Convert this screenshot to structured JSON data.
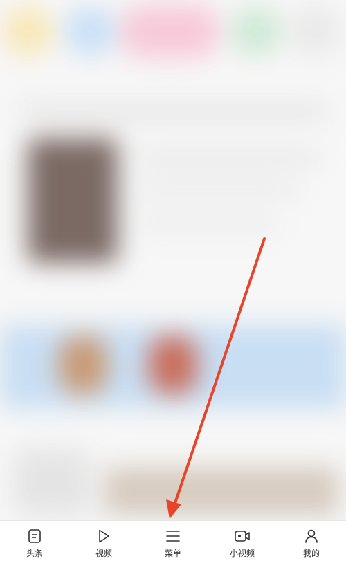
{
  "bottom_nav": {
    "items": [
      {
        "label": "头条",
        "icon": "headlines-icon"
      },
      {
        "label": "视频",
        "icon": "play-icon"
      },
      {
        "label": "菜单",
        "icon": "menu-icon"
      },
      {
        "label": "小视频",
        "icon": "small-video-icon"
      },
      {
        "label": "我的",
        "icon": "profile-icon"
      }
    ]
  },
  "colors": {
    "arrow": "#e8442a",
    "icon": "#333333",
    "nav_background": "#ffffff"
  }
}
